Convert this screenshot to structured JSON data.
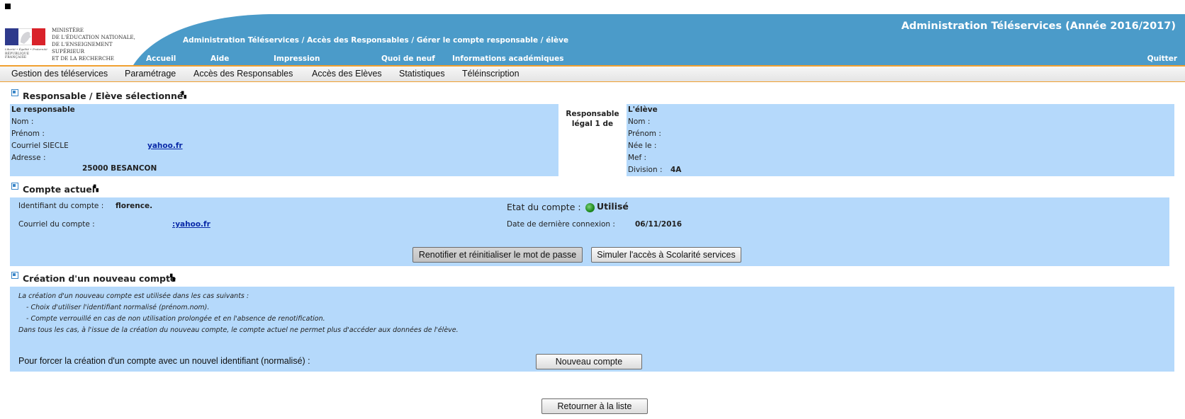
{
  "header": {
    "logo_lines": [
      "MINISTÈRE",
      "DE L'ÉDUCATION NATIONALE,",
      "DE L'ENSEIGNEMENT SUPÉRIEUR",
      "ET DE LA RECHERCHE"
    ],
    "logo_devise": "Liberté • Égalité • Fraternité",
    "logo_rf": "RÉPUBLIQUE FRANÇAISE",
    "app_title": "Administration Téléservices (Année 2016/2017)",
    "breadcrumb": "Administration Téléservices / Accès des Responsables / Gérer le compte responsable / élève",
    "nav": {
      "accueil": "Accueil",
      "aide": "Aide",
      "impression": "Impression",
      "quoi_de_neuf": "Quoi de neuf",
      "infos": "Informations académiques"
    },
    "quit": "Quitter",
    "banner_color": "#4b9bc9"
  },
  "menu": {
    "gestion": "Gestion des téléservices",
    "parametrage": "Paramétrage",
    "acces_resp": "Accès des Responsables",
    "acces_eleves": "Accès des Elèves",
    "stats": "Statistiques",
    "teleinscription": "Téléinscription"
  },
  "selected": {
    "title": "Responsable / Elève sélectionné",
    "responsable": {
      "heading": "Le responsable",
      "nom_label": "Nom :",
      "prenom_label": "Prénom :",
      "courriel_label": "Courriel SIECLE",
      "courriel_value": "yahoo.fr",
      "adresse_label": "Adresse :",
      "adresse_value": "25000 BESANCON"
    },
    "relation": "Responsable légal 1 de",
    "eleve": {
      "heading": "L'élève",
      "nom_label": "Nom :",
      "prenom_label": "Prénom :",
      "nee_label": "Née le :",
      "mef_label": "Mef :",
      "division_label": "Division :",
      "division_value": "4A"
    }
  },
  "account": {
    "title": "Compte actuel",
    "id_label": "Identifiant du compte :",
    "id_value": "florence.",
    "courriel_label": "Courriel du compte :",
    "courriel_value": ":yahoo.fr",
    "etat_label": "Etat du compte :",
    "etat_value": "Utilisé",
    "last_login_label": "Date de dernière connexion :",
    "last_login_value": "06/11/2016",
    "btn_renotify": "Renotifier et réinitialiser le mot de passe",
    "btn_simulate": "Simuler l'accès à Scolarité services"
  },
  "new_account": {
    "title": "Création d'un nouveau compte",
    "info_1": "La création d'un nouveau compte est utilisée dans les cas suivants :",
    "info_2": "- Choix d'utiliser l'identifiant normalisé (prénom.nom).",
    "info_3": "- Compte verrouillé en cas de non utilisation prolongée et en l'absence de renotification.",
    "info_4": "Dans tous les cas, à l'issue de la création du nouveau compte, le compte actuel ne permet plus d'accéder aux données de l'élève.",
    "force_label": "Pour forcer la création d'un compte avec un nouvel identifiant (normalisé) :",
    "btn_new": "Nouveau compte"
  },
  "footer": {
    "btn_back": "Retourner à la liste"
  },
  "colors": {
    "panel": "#b5d9fb",
    "accent_orange": "#f0a030",
    "link": "#0a2aa8"
  }
}
